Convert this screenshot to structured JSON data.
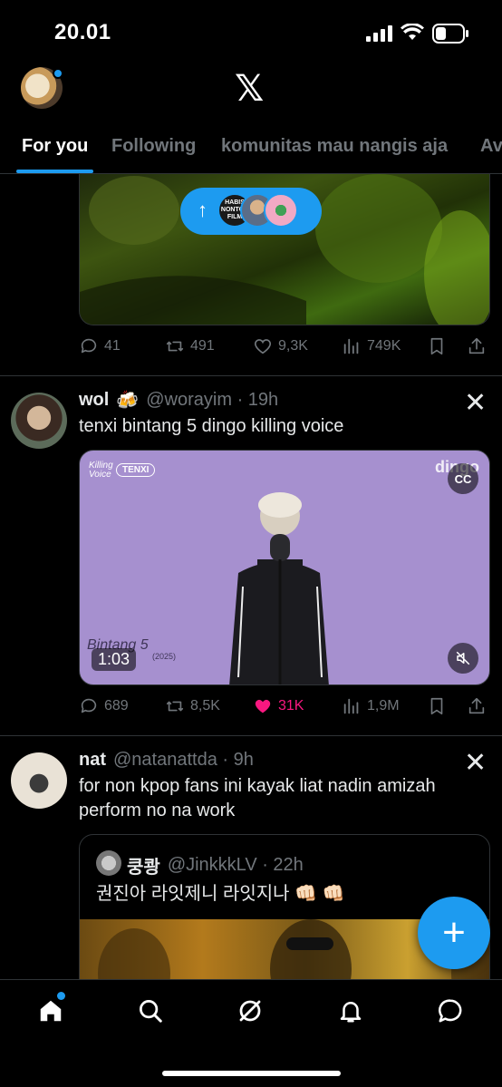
{
  "status_bar": {
    "time": "20.01"
  },
  "header": {
    "logo": "𝕏"
  },
  "tabs": [
    "For you",
    "Following",
    "komunitas mau nangis aja",
    "Av"
  ],
  "new_posts_pill": {
    "arrow": "↑",
    "avatar1_text": "HABIS NONTON FILM"
  },
  "post_top": {
    "stats": {
      "replies": "41",
      "reposts": "491",
      "likes": "9,3K",
      "views": "749K"
    }
  },
  "post1": {
    "display_name": "wol",
    "emoji": "🍻",
    "handle_time": "@worayim · 19h",
    "text": "tenxi bintang 5 dingo killing voice",
    "video": {
      "title_small": "Killing Voice",
      "tag": "TENXI",
      "brand": "dingo",
      "cc": "CC",
      "overlay_title": "Bintang 5",
      "overlay_sub": "(2025)",
      "duration": "1:03"
    },
    "stats": {
      "replies": "689",
      "reposts": "8,5K",
      "likes": "31K",
      "views": "1,9M"
    }
  },
  "post2": {
    "display_name": "nat",
    "handle_time": "@natanattda · 9h",
    "text_line1": "for non kpop fans ini kayak liat nadin amizah",
    "text_line2": "perform no na work",
    "quote": {
      "display_name": "쿵쾅",
      "handle_time": "@JinkkkLV · 22h",
      "text": "권진아 라잇제니 라잇지나 👊🏻 👊🏻"
    }
  },
  "fab": {
    "label": "+"
  },
  "colors": {
    "accent": "#1d9bf0",
    "like": "#f91880",
    "muted": "#71767b",
    "divider": "#2f3336"
  },
  "nav": [
    "home-icon",
    "search-icon",
    "grok-icon",
    "bell-icon",
    "messages-icon"
  ]
}
